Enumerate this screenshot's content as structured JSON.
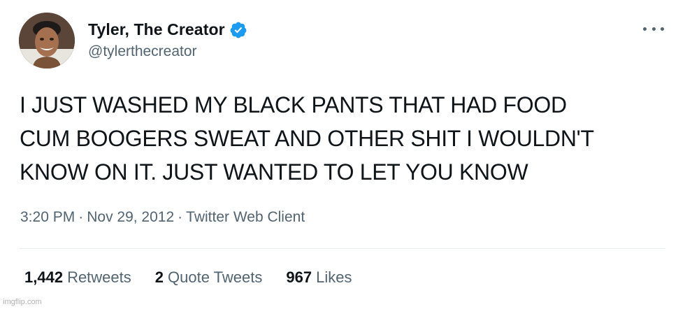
{
  "user": {
    "display_name": "Tyler, The Creator",
    "handle": "@tylerthecreator",
    "verified": true,
    "verified_color": "#1d9bf0",
    "avatar_icon": "profile-photo"
  },
  "tweet": {
    "lines": [
      "I JUST WASHED MY BLACK PANTS THAT HAD FOOD",
      "CUM BOOGERS SWEAT AND OTHER SHIT I WOULDN'T",
      "KNOW ON IT. JUST WANTED TO LET YOU KNOW"
    ],
    "time": "3:20 PM",
    "date": "Nov 29, 2012",
    "source": "Twitter Web Client",
    "separator": "·"
  },
  "stats": {
    "retweets_count": "1,442",
    "retweets_label": "Retweets",
    "quote_count": "2",
    "quote_label": "Quote Tweets",
    "likes_count": "967",
    "likes_label": "Likes"
  },
  "watermark": "imgflip.com",
  "colors": {
    "text_primary": "#0f1419",
    "text_secondary": "#536471",
    "divider": "#e6ecf0"
  }
}
